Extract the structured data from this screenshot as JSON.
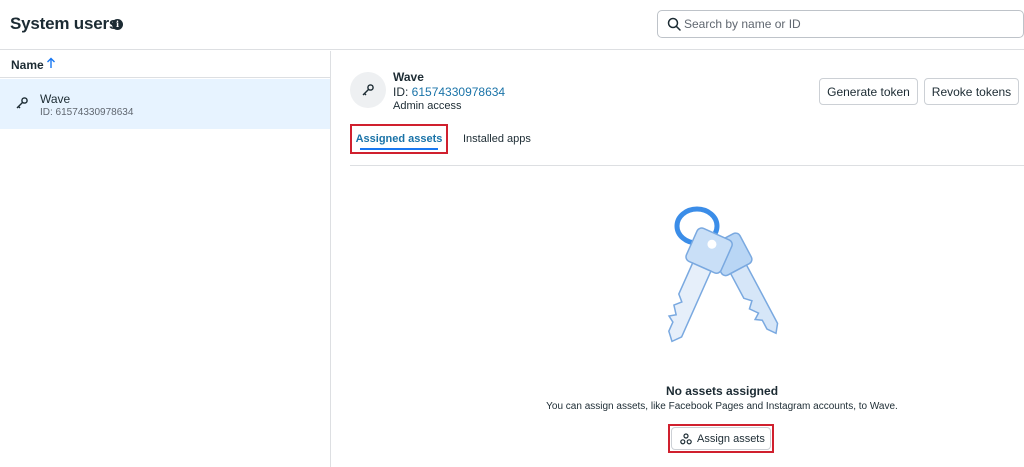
{
  "header": {
    "title": "System users",
    "info_icon": "info-icon",
    "search_placeholder": "Search by name or ID"
  },
  "list": {
    "column_header": "Name",
    "sort": "ascending",
    "users": [
      {
        "name": "Wave",
        "id_text": "ID: 61574330978634",
        "icon": "key-icon",
        "selected": true
      }
    ]
  },
  "detail": {
    "name": "Wave",
    "id_prefix": "ID: ",
    "id_value": "61574330978634",
    "access": "Admin access",
    "generate_token_label": "Generate token",
    "revoke_tokens_label": "Revoke tokens",
    "tabs": [
      {
        "label": "Assigned assets",
        "active": true
      },
      {
        "label": "Installed apps",
        "active": false
      }
    ]
  },
  "empty_state": {
    "illustration": "keys-illustration",
    "title": "No assets assigned",
    "description": "You can assign assets, like Facebook Pages and Instagram accounts, to Wave.",
    "button_label": "Assign assets",
    "button_icon": "assets-icon"
  },
  "colors": {
    "link": "#1a73a8",
    "selected_row": "#e7f3ff",
    "highlight_border": "#d0202e",
    "text": "#1c2b33"
  }
}
